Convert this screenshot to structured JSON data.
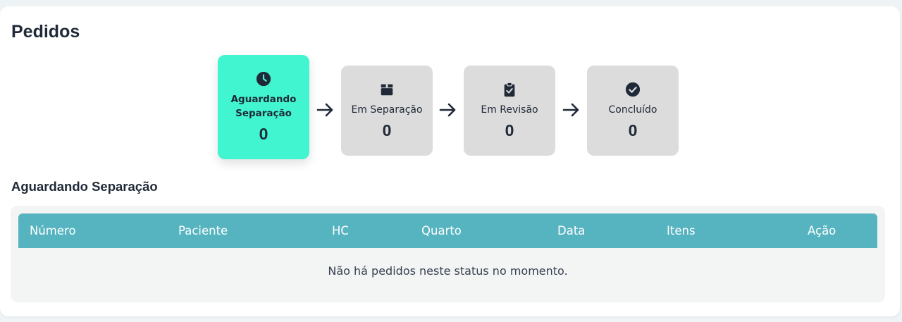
{
  "page": {
    "title": "Pedidos"
  },
  "colors": {
    "active_step": "#40f5cf",
    "inactive_step": "#dcdcdc",
    "table_header": "#56b4c0",
    "text_dark": "#1f2937"
  },
  "stepper": {
    "steps": [
      {
        "label": "Aguardando Separação",
        "count": "0",
        "icon": "clock-icon",
        "active": true
      },
      {
        "label": "Em Separação",
        "count": "0",
        "icon": "box-icon",
        "active": false
      },
      {
        "label": "Em Revisão",
        "count": "0",
        "icon": "clipboard-check-icon",
        "active": false
      },
      {
        "label": "Concluído",
        "count": "0",
        "icon": "check-circle-icon",
        "active": false
      }
    ],
    "separator_icon": "arrow-right-icon"
  },
  "section": {
    "title": "Aguardando Separação"
  },
  "table": {
    "columns": [
      "Número",
      "Paciente",
      "HC",
      "Quarto",
      "Data",
      "Itens",
      "Ação"
    ],
    "empty_message": "Não há pedidos neste status no momento."
  }
}
